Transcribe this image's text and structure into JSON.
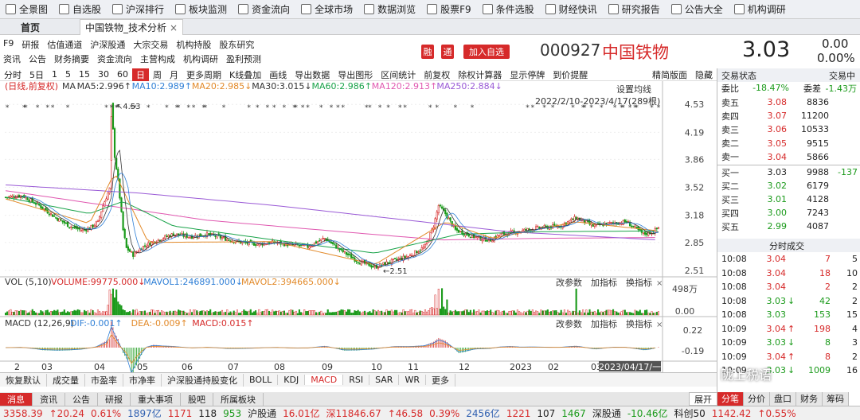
{
  "toolbar": {
    "items": [
      {
        "label": "全景图",
        "icon": "panorama-icon"
      },
      {
        "label": "自选股",
        "icon": "star-icon"
      },
      {
        "label": "沪深排行",
        "icon": "ranking-icon"
      },
      {
        "label": "板块监测",
        "icon": "sector-icon"
      },
      {
        "label": "资金流向",
        "icon": "money-flow-icon"
      },
      {
        "label": "全球市场",
        "icon": "globe-icon"
      },
      {
        "label": "数据浏览",
        "icon": "data-icon"
      },
      {
        "label": "股票F9",
        "icon": "f9-icon"
      },
      {
        "label": "条件选股",
        "icon": "filter-icon"
      },
      {
        "label": "财经快讯",
        "icon": "news-icon"
      },
      {
        "label": "研究报告",
        "icon": "report-icon"
      },
      {
        "label": "公告大全",
        "icon": "notice-icon"
      },
      {
        "label": "机构调研",
        "icon": "research-icon"
      }
    ]
  },
  "tabs": {
    "home": "首页",
    "stock": "中国铁物_技术分析",
    "close": "×"
  },
  "menu": {
    "row1": [
      "F9",
      "研报",
      "估值通道",
      "沪深股通",
      "大宗交易",
      "机构持股",
      "股东研究"
    ],
    "row2": [
      "资讯",
      "公告",
      "财务摘要",
      "资金流向",
      "主营构成",
      "机构调研",
      "盈利预测"
    ]
  },
  "quote": {
    "rong": "融",
    "tong": "通",
    "add": "加入自选",
    "code": "000927",
    "name": "中国铁物",
    "price": "3.03",
    "change": "0.00",
    "pct": "0.00%"
  },
  "periods": [
    "分时",
    "5日",
    "1",
    "5",
    "15",
    "30",
    "60",
    "日",
    "周",
    "月",
    "更多周期",
    "K线叠加",
    "画线",
    "导出数据",
    "导出图形",
    "区间统计",
    "前复权",
    "除权计算器",
    "显示停牌",
    "到价提醒",
    "精简版面",
    "隐藏"
  ],
  "selected_period": "日",
  "chart_data": {
    "type": "candlestick",
    "header": "(日线,前复权)",
    "ma_labels": [
      {
        "text": "MA",
        "color": "#333333"
      },
      {
        "text": "MA5:2.996↑",
        "color": "#333333"
      },
      {
        "text": "MA10:2.989↑",
        "color": "#2f7fd6"
      },
      {
        "text": "MA20:2.985↓",
        "color": "#e28a2a"
      },
      {
        "text": "MA30:3.015↓",
        "color": "#333333"
      },
      {
        "text": "MA60:2.986↑",
        "color": "#1aa34a"
      },
      {
        "text": "MA120:2.913↑",
        "color": "#e058b0"
      },
      {
        "text": "MA250:2.884↓",
        "color": "#9a5ad6"
      }
    ],
    "setting": "设置均线",
    "range_text": "2022/2/10-2023/4/17(289根)",
    "y_ticks": [
      "4.53",
      "4.19",
      "3.86",
      "3.52",
      "3.18",
      "2.85",
      "2.51"
    ],
    "ylim": [
      2.47,
      4.6
    ],
    "max_label": "4.53",
    "min_label": "2.51",
    "x_labels": [
      "2",
      "03",
      "04",
      "05",
      "06",
      "07",
      "08",
      "09",
      "10",
      "11",
      "12",
      "2023",
      "02",
      "03",
      "2023/04/17/一"
    ],
    "close_anchors": [
      [
        0,
        3.4
      ],
      [
        10,
        3.42
      ],
      [
        20,
        3.3
      ],
      [
        30,
        3.15
      ],
      [
        38,
        3.05
      ],
      [
        45,
        3.0
      ],
      [
        50,
        3.02
      ],
      [
        55,
        3.1
      ],
      [
        58,
        3.3
      ],
      [
        62,
        3.5
      ],
      [
        63,
        4.53
      ],
      [
        65,
        3.9
      ],
      [
        67,
        3.6
      ],
      [
        70,
        3.0
      ],
      [
        72,
        2.78
      ],
      [
        76,
        2.7
      ],
      [
        82,
        2.8
      ],
      [
        90,
        2.88
      ],
      [
        100,
        2.95
      ],
      [
        110,
        2.92
      ],
      [
        120,
        2.95
      ],
      [
        130,
        2.9
      ],
      [
        140,
        2.85
      ],
      [
        150,
        2.83
      ],
      [
        160,
        2.85
      ],
      [
        170,
        2.82
      ],
      [
        180,
        2.8
      ],
      [
        190,
        2.9
      ],
      [
        200,
        2.75
      ],
      [
        210,
        2.62
      ],
      [
        220,
        2.55
      ],
      [
        230,
        2.62
      ],
      [
        240,
        2.68
      ],
      [
        250,
        2.8
      ],
      [
        255,
        3.05
      ],
      [
        258,
        3.3
      ],
      [
        262,
        3.2
      ],
      [
        268,
        3.0
      ],
      [
        275,
        2.95
      ],
      [
        282,
        2.9
      ],
      [
        289,
        2.88
      ],
      [
        295,
        2.95
      ],
      [
        305,
        2.98
      ],
      [
        315,
        3.02
      ],
      [
        330,
        3.05
      ],
      [
        340,
        3.15
      ],
      [
        350,
        3.05
      ],
      [
        360,
        3.08
      ],
      [
        370,
        3.1
      ],
      [
        380,
        2.95
      ],
      [
        386,
        2.98
      ],
      [
        389,
        3.03
      ]
    ],
    "ma_series": [
      {
        "name": "MA120",
        "color": "#e058b0",
        "anchors": [
          [
            0,
            3.48
          ],
          [
            60,
            3.3
          ],
          [
            120,
            3.12
          ],
          [
            200,
            2.98
          ],
          [
            260,
            2.88
          ],
          [
            320,
            2.9
          ],
          [
            389,
            2.91
          ]
        ]
      },
      {
        "name": "MA250",
        "color": "#9a5ad6",
        "anchors": [
          [
            0,
            3.55
          ],
          [
            80,
            3.45
          ],
          [
            160,
            3.3
          ],
          [
            240,
            3.12
          ],
          [
            300,
            2.98
          ],
          [
            389,
            2.88
          ]
        ]
      },
      {
        "name": "MA60",
        "color": "#1aa34a",
        "anchors": [
          [
            0,
            3.4
          ],
          [
            50,
            3.2
          ],
          [
            70,
            3.35
          ],
          [
            100,
            3.05
          ],
          [
            160,
            2.88
          ],
          [
            220,
            2.72
          ],
          [
            270,
            2.95
          ],
          [
            320,
            2.98
          ],
          [
            389,
            2.99
          ]
        ]
      },
      {
        "name": "MA20",
        "color": "#e28a2a",
        "anchors": [
          [
            0,
            3.38
          ],
          [
            50,
            3.08
          ],
          [
            65,
            3.7
          ],
          [
            85,
            2.85
          ],
          [
            160,
            2.86
          ],
          [
            220,
            2.58
          ],
          [
            262,
            3.1
          ],
          [
            290,
            2.9
          ],
          [
            340,
            3.1
          ],
          [
            389,
            2.99
          ]
        ]
      }
    ],
    "volume": {
      "label": "VOL (5,10)",
      "values": [
        {
          "text": "VOLUME:99775.000↓",
          "color": "#d62a2a"
        },
        {
          "text": "MAVOL1:246891.000↓",
          "color": "#2f7fd6"
        },
        {
          "text": "MAVOL2:394665.000↓",
          "color": "#e28a2a"
        }
      ],
      "y_ticks": [
        "498万",
        "0.00"
      ],
      "spike_days": [
        62,
        63,
        64,
        66,
        256,
        258,
        260,
        340
      ]
    },
    "macd": {
      "label": "MACD (12,26,9)",
      "values": [
        {
          "text": "DIF:-0.001↑",
          "color": "#2f7fd6"
        },
        {
          "text": "DEA:-0.009↑",
          "color": "#e28a2a"
        },
        {
          "text": "MACD:0.015↑",
          "color": "#d62a2a"
        }
      ],
      "y_ticks": [
        "0.22",
        "-0.19"
      ]
    }
  },
  "panel_links": [
    "改参数",
    "加指标",
    "换指标"
  ],
  "bottom_tabs": [
    "恢复默认",
    "成交量",
    "市盈率",
    "市净率",
    "沪深股通持股变化",
    "BOLL",
    "KDJ",
    "MACD",
    "RSI",
    "SAR",
    "WR",
    "更多"
  ],
  "selected_bottom": "MACD",
  "info_tabs": [
    "消息",
    "资讯",
    "公告",
    "研报",
    "重大事项",
    "股吧",
    "所属板块"
  ],
  "right": {
    "title": "交易状态",
    "title2": "交易中",
    "webi_label": "委比",
    "webi": "-18.47%",
    "weicha_label": "委差",
    "weicha": "-1.43万",
    "sells": [
      {
        "label": "卖五",
        "price": "3.08",
        "vol": "8836"
      },
      {
        "label": "卖四",
        "price": "3.07",
        "vol": "11200"
      },
      {
        "label": "卖三",
        "price": "3.06",
        "vol": "10533"
      },
      {
        "label": "卖二",
        "price": "3.05",
        "vol": "9515"
      },
      {
        "label": "卖一",
        "price": "3.04",
        "vol": "5866"
      }
    ],
    "buys": [
      {
        "label": "买一",
        "price": "3.03",
        "vol": "9988",
        "chg": "-137"
      },
      {
        "label": "买二",
        "price": "3.02",
        "vol": "6179",
        "chg": ""
      },
      {
        "label": "买三",
        "price": "3.01",
        "vol": "4128",
        "chg": ""
      },
      {
        "label": "买四",
        "price": "3.00",
        "vol": "7243",
        "chg": ""
      },
      {
        "label": "买五",
        "price": "2.99",
        "vol": "4087",
        "chg": ""
      }
    ],
    "ticks_title": "分时成交",
    "ticks": [
      {
        "time": "10:08",
        "price": "3.04",
        "arrow": "",
        "vol": "7",
        "n": "5",
        "c": "up"
      },
      {
        "time": "10:08",
        "price": "3.04",
        "arrow": "",
        "vol": "18",
        "n": "10",
        "c": "up"
      },
      {
        "time": "10:08",
        "price": "3.04",
        "arrow": "",
        "vol": "2",
        "n": "2",
        "c": "up"
      },
      {
        "time": "10:08",
        "price": "3.03",
        "arrow": "↓",
        "vol": "42",
        "n": "2",
        "c": "dn"
      },
      {
        "time": "10:08",
        "price": "3.03",
        "arrow": "",
        "vol": "153",
        "n": "15",
        "c": "dn"
      },
      {
        "time": "10:09",
        "price": "3.04",
        "arrow": "↑",
        "vol": "198",
        "n": "4",
        "c": "up"
      },
      {
        "time": "10:09",
        "price": "3.03",
        "arrow": "↓",
        "vol": "8",
        "n": "3",
        "c": "dn"
      },
      {
        "time": "10:09",
        "price": "3.04",
        "arrow": "↑",
        "vol": "8",
        "n": "2",
        "c": "up"
      },
      {
        "time": "10:09",
        "price": "3.03",
        "arrow": "↓",
        "vol": "1009",
        "n": "16",
        "c": "dn"
      }
    ],
    "expand": "展开",
    "bottom_tabs": [
      "分笔",
      "分价",
      "盘口",
      "财务",
      "筹码"
    ]
  },
  "status": [
    {
      "text": "3358.39",
      "c": "up"
    },
    {
      "text": "↑20.24",
      "c": "up"
    },
    {
      "text": "0.61%",
      "c": "up"
    },
    {
      "text": "1897亿",
      "c": "blue"
    },
    {
      "text": "1171",
      "c": "up"
    },
    {
      "text": "118",
      "c": ""
    },
    {
      "text": "953",
      "c": "dn"
    },
    {
      "text": "沪股通",
      "c": ""
    },
    {
      "text": "16.01亿",
      "c": "up"
    },
    {
      "text": "深11846.67",
      "c": "up"
    },
    {
      "text": "↑46.58",
      "c": "up"
    },
    {
      "text": "0.39%",
      "c": "up"
    },
    {
      "text": "2456亿",
      "c": "blue"
    },
    {
      "text": "1221",
      "c": "up"
    },
    {
      "text": "107",
      "c": ""
    },
    {
      "text": "1467",
      "c": "dn"
    },
    {
      "text": "深股通",
      "c": ""
    },
    {
      "text": "-10.46亿",
      "c": "dn"
    },
    {
      "text": "科创50",
      "c": ""
    },
    {
      "text": "1142.42",
      "c": "up"
    },
    {
      "text": "↑0.55%",
      "c": "up"
    }
  ],
  "watermark": "陇上税语"
}
